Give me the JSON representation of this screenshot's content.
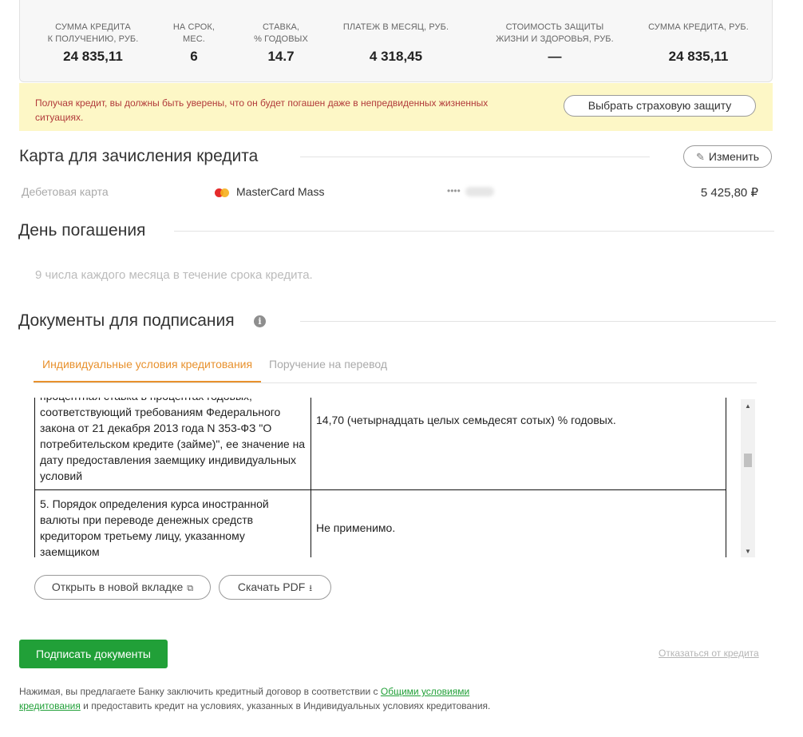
{
  "summary": {
    "items": [
      {
        "label": "СУММА КРЕДИТА\nК ПОЛУЧЕНИЮ, РУБ.",
        "value": "24 835,11"
      },
      {
        "label": "НА СРОК,\nМЕС.",
        "value": "6"
      },
      {
        "label": "СТАВКА,\n% ГОДОВЫХ",
        "value": "14.7"
      },
      {
        "label": "ПЛАТЕЖ В МЕСЯЦ, РУБ.",
        "value": "4 318,45"
      },
      {
        "label": "СТОИМОСТЬ ЗАЩИТЫ\nЖИЗНИ И ЗДОРОВЬЯ, РУБ.",
        "value": "—"
      },
      {
        "label": "СУММА КРЕДИТА, РУБ.",
        "value": "24 835,11"
      }
    ]
  },
  "warning": {
    "text": "Получая кредит, вы должны быть уверены, что он будет погашен даже в непредвиденных жизненных ситуациях.",
    "button_label": "Выбрать страховую защиту"
  },
  "card_section": {
    "title": "Карта для зачисления кредита",
    "edit_label": "Изменить",
    "card_type": "Дебетовая карта",
    "card_name": "MasterCard Mass",
    "card_mask": "••••",
    "balance": "5 425,80 ₽"
  },
  "payday_section": {
    "title": "День погашения",
    "text": "9 числа каждого месяца в течение срока кредита."
  },
  "documents_section": {
    "title": "Документы для подписания",
    "info_icon": "info-icon",
    "tabs": [
      {
        "label": "Индивидуальные условия кредитования",
        "active": true
      },
      {
        "label": "Поручение на перевод",
        "active": false
      }
    ],
    "rows": [
      {
        "left": "процентная ставка в процентах годовых, соответствующий требованиям Федерального закона от 21 декабря 2013 года N 353-ФЗ \"О потребительском кредите (займе)\", ее значение на дату предоставления заемщику индивидуальных условий",
        "right": "14,70 (четырнадцать целых семьдесят сотых) % годовых."
      },
      {
        "left": "5. Порядок определения курса иностранной валюты при переводе денежных средств кредитором третьему лицу, указанному заемщиком",
        "right": "Не применимо."
      }
    ],
    "open_tab_label": "Открыть в новой вкладке",
    "download_label": "Скачать PDF"
  },
  "actions": {
    "sign_label": "Подписать документы",
    "refuse_label": "Отказаться от кредита"
  },
  "footer": {
    "text_before": "Нажимая, вы предлагаете Банку заключить кредитный договор в соответствии с ",
    "link_label": "Общими условиями кредитования",
    "text_after": " и предоставить кредит на условиях, указанных в Индивидуальных условиях кредитования."
  },
  "colors": {
    "accent_green": "#21a038",
    "tab_orange": "#e8912d",
    "warning_bg": "#fdf7c6",
    "warning_text": "#b13a3a"
  }
}
